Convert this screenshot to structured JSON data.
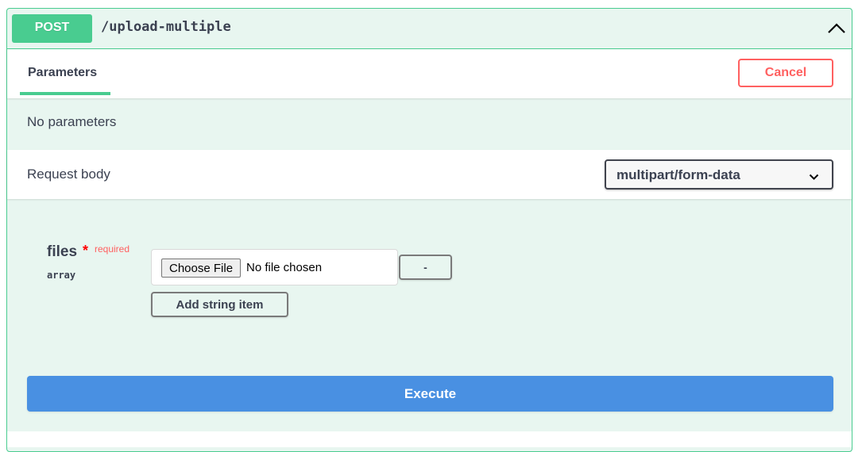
{
  "operation": {
    "method": "POST",
    "path": "/upload-multiple",
    "method_color": "#49cc90"
  },
  "parameters": {
    "tab_label": "Parameters",
    "cancel_label": "Cancel",
    "empty_text": "No parameters"
  },
  "request_body": {
    "title": "Request body",
    "content_type": "multipart/form-data",
    "fields": [
      {
        "name": "files",
        "required_marker": "*",
        "required_text": "required",
        "type": "array",
        "choose_file_label": "Choose File",
        "file_status": "No file chosen",
        "remove_label": "-",
        "add_item_label": "Add string item"
      }
    ]
  },
  "execute_label": "Execute",
  "icons": {
    "collapse": "chevron-up-icon",
    "content_type_dropdown": "chevron-down-icon"
  },
  "colors": {
    "accent": "#49cc90",
    "cancel": "#ff6060",
    "execute": "#4990e2",
    "panel_bg": "#e8f6f0"
  }
}
